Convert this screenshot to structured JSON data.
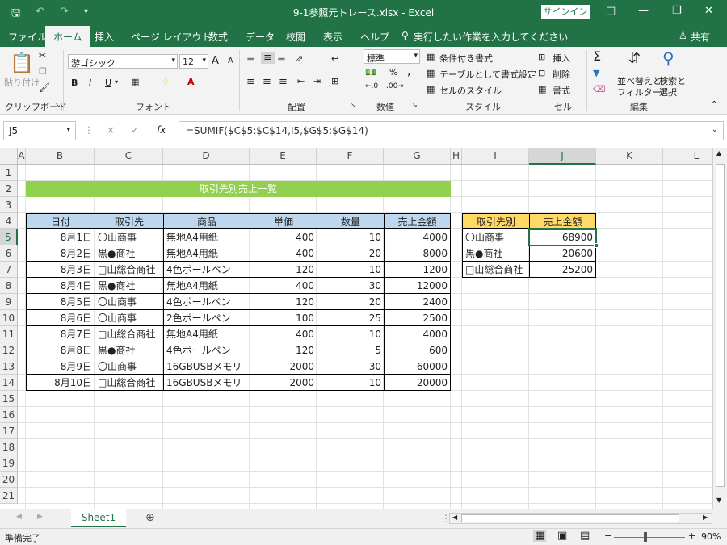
{
  "window": {
    "title": "9-1参照元トレース.xlsx  -  Excel",
    "signin_label": "サインイン",
    "share_label": "共有",
    "colors": {
      "excel_green": "#217346",
      "title_fill": "#92D050",
      "header_fill": "#BDD7EE",
      "summary_fill": "#FFD966"
    }
  },
  "menu": {
    "tabs": [
      "ファイル",
      "ホーム",
      "挿入",
      "ページ レイアウト",
      "数式",
      "データ",
      "校閲",
      "表示",
      "ヘルプ"
    ],
    "tell_me": "実行したい作業を入力してください"
  },
  "ribbon": {
    "clipboard": {
      "paste": "貼り付け",
      "label": "クリップボード"
    },
    "font": {
      "name": "游ゴシック",
      "size": "12",
      "grow": "A",
      "shrink": "A",
      "bold": "B",
      "italic": "I",
      "underline": "U",
      "color_a": "A",
      "label": "フォント"
    },
    "alignment": {
      "label": "配置"
    },
    "number": {
      "format": "標準",
      "percent": "%",
      "comma": ",",
      "label": "数値"
    },
    "styles": {
      "conditional": "条件付き書式",
      "table": "テーブルとして書式設定",
      "cell": "セルのスタイル",
      "label": "スタイル"
    },
    "cells": {
      "insert": "挿入",
      "delete": "削除",
      "format": "書式",
      "label": "セル"
    },
    "editing": {
      "sort": "並べ替えと",
      "filter": "フィルター",
      "find": "検索と",
      "select": "選択",
      "label": "編集"
    }
  },
  "formula_bar": {
    "name_box": "J5",
    "cancel": "×",
    "enter": "✓",
    "fx": "fx",
    "formula": "=SUMIF($C$5:$C$14,I5,$G$5:$G$14)"
  },
  "columns": [
    "A",
    "B",
    "C",
    "D",
    "E",
    "F",
    "G",
    "H",
    "I",
    "J",
    "K",
    "L"
  ],
  "rows": [
    "1",
    "2",
    "3",
    "4",
    "5",
    "6",
    "7",
    "8",
    "9",
    "10",
    "11",
    "12",
    "13",
    "14",
    "15",
    "16",
    "17",
    "18",
    "19",
    "20",
    "21"
  ],
  "sheet": {
    "title": "取引先別売上一覧",
    "headers": [
      "日付",
      "取引先",
      "商品",
      "単価",
      "数量",
      "売上金額"
    ],
    "data": [
      [
        "8月1日",
        "〇山商事",
        "無地A4用紙",
        "400",
        "10",
        "4000"
      ],
      [
        "8月2日",
        "黒●商社",
        "無地A4用紙",
        "400",
        "20",
        "8000"
      ],
      [
        "8月3日",
        "□山総合商社",
        "4色ボールペン",
        "120",
        "10",
        "1200"
      ],
      [
        "8月4日",
        "黒●商社",
        "無地A4用紙",
        "400",
        "30",
        "12000"
      ],
      [
        "8月5日",
        "〇山商事",
        "4色ボールペン",
        "120",
        "20",
        "2400"
      ],
      [
        "8月6日",
        "〇山商事",
        "2色ボールペン",
        "100",
        "25",
        "2500"
      ],
      [
        "8月7日",
        "□山総合商社",
        "無地A4用紙",
        "400",
        "10",
        "4000"
      ],
      [
        "8月8日",
        "黒●商社",
        "4色ボールペン",
        "120",
        "5",
        "600"
      ],
      [
        "8月9日",
        "〇山商事",
        "16GBUSBメモリ",
        "2000",
        "30",
        "60000"
      ],
      [
        "8月10日",
        "□山総合商社",
        "16GBUSBメモリ",
        "2000",
        "10",
        "20000"
      ]
    ],
    "summary_headers": [
      "取引先別",
      "売上金額"
    ],
    "summary": [
      [
        "〇山商事",
        "68900"
      ],
      [
        "黒●商社",
        "20600"
      ],
      [
        "□山総合商社",
        "25200"
      ]
    ]
  },
  "sheet_tabs": [
    "Sheet1"
  ],
  "status": {
    "text": "準備完了",
    "zoom": "90%"
  }
}
